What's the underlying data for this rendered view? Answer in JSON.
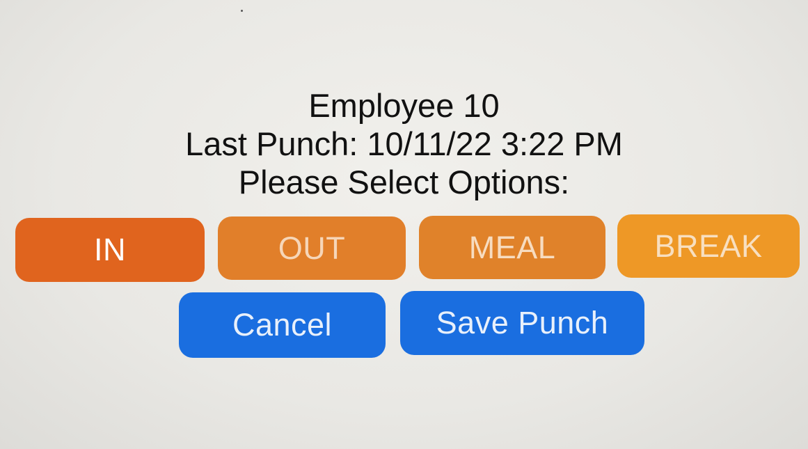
{
  "header": {
    "employee": "Employee 10",
    "last_punch": "Last Punch: 10/11/22 3:22 PM",
    "prompt": "Please Select Options:"
  },
  "options": {
    "in_label": "IN",
    "out_label": "OUT",
    "meal_label": "MEAL",
    "break_label": "BREAK"
  },
  "actions": {
    "cancel_label": "Cancel",
    "save_label": "Save Punch"
  },
  "colors": {
    "in": "#e0641e",
    "out": "#e17f2a",
    "meal": "#e0822a",
    "break": "#ee9826",
    "action_blue": "#1a6ee0",
    "background": "#eceae6"
  }
}
